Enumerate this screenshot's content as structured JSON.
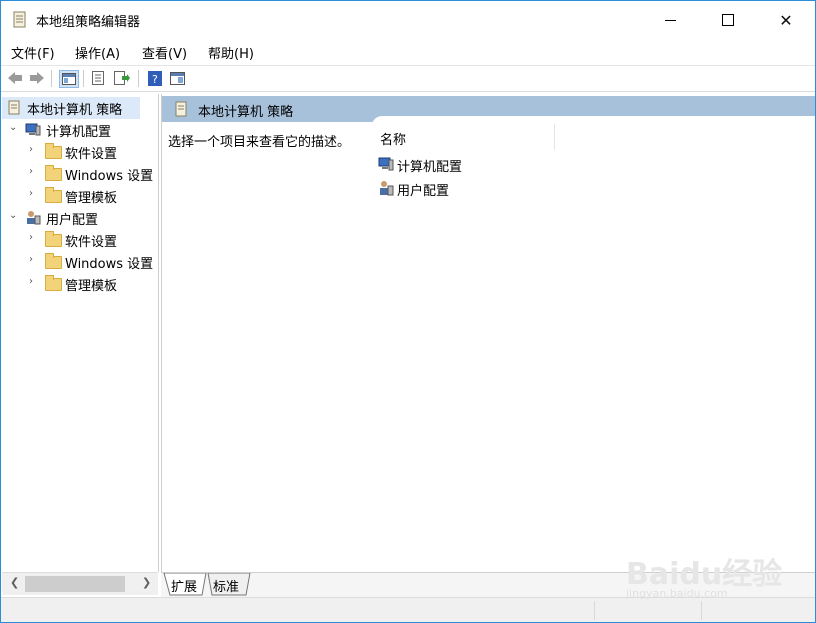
{
  "window": {
    "title": "本地组策略编辑器"
  },
  "menu": {
    "items": [
      "文件(F)",
      "操作(A)",
      "查看(V)",
      "帮助(H)"
    ]
  },
  "tree": {
    "root": "本地计算机 策略",
    "computer": "计算机配置",
    "computer_children": [
      "软件设置",
      "Windows 设置",
      "管理模板"
    ],
    "user": "用户配置",
    "user_children": [
      "软件设置",
      "Windows 设置",
      "管理模板"
    ]
  },
  "main": {
    "header": "本地计算机 策略",
    "description": "选择一个项目来查看它的描述。",
    "column_name": "名称",
    "items": [
      "计算机配置",
      "用户配置"
    ]
  },
  "tabs": [
    "扩展",
    "标准"
  ],
  "watermark": {
    "brand": "Baidu经验",
    "url": "jingyan.baidu.com"
  },
  "colors": {
    "header_bg": "#a7c1db",
    "selection_bg": "#dce9f8",
    "folder": "#f3d37a"
  }
}
